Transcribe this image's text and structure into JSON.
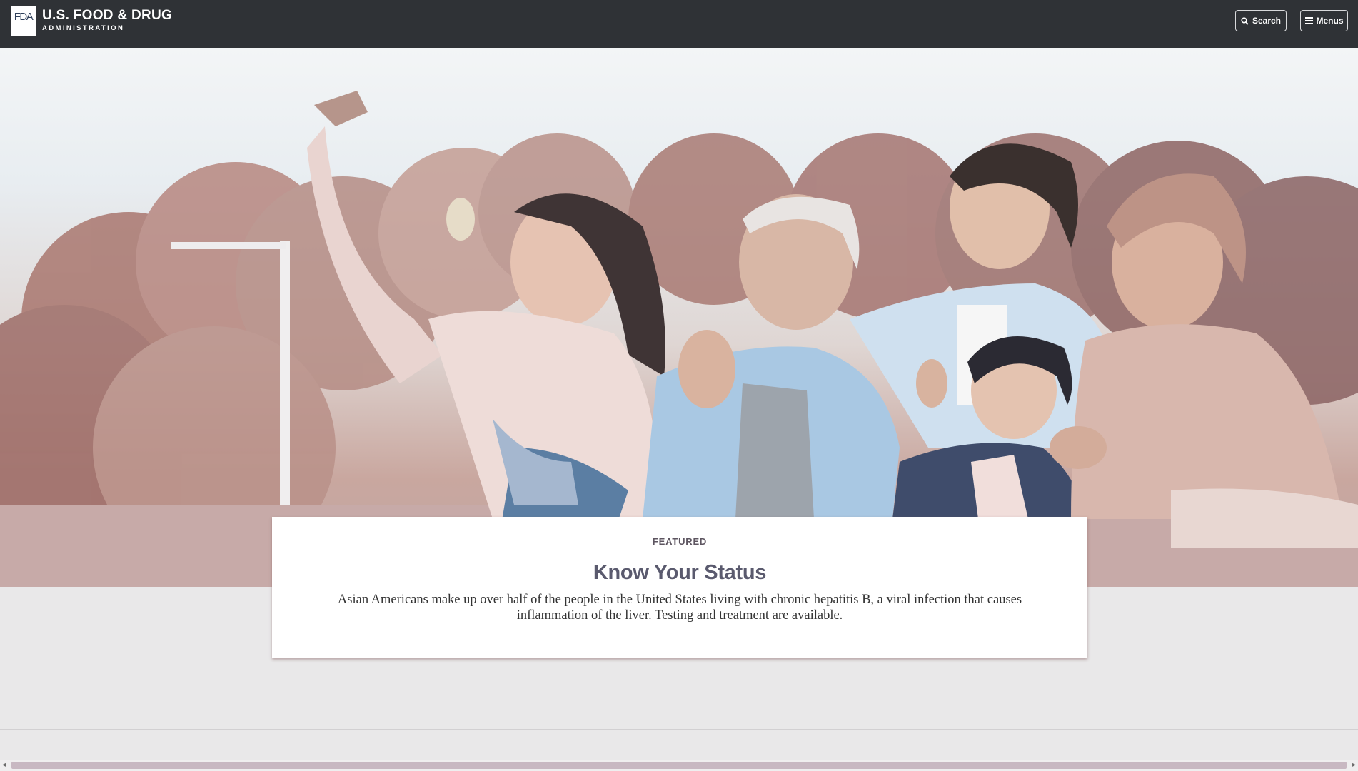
{
  "header": {
    "logo_mark": "FDA",
    "logo_title": "U.S. FOOD & DRUG",
    "logo_subtitle": "ADMINISTRATION",
    "search_label": "Search",
    "menus_label": "Menus",
    "search_icon": "search-icon",
    "menu_icon": "hamburger-icon"
  },
  "hero": {
    "image_subject": "family-selfie-photo"
  },
  "featured": {
    "eyebrow": "FEATURED",
    "title": "Know Your Status",
    "description": "Asian Americans make up over half of the people in the United States living with chronic hepatitis B, a viral infection that causes inflammation of the liver. Testing and treatment are available."
  },
  "colors": {
    "header_bg": "#2f3236",
    "page_bg": "#e9e8e9",
    "title_color": "#5a5a6e"
  }
}
